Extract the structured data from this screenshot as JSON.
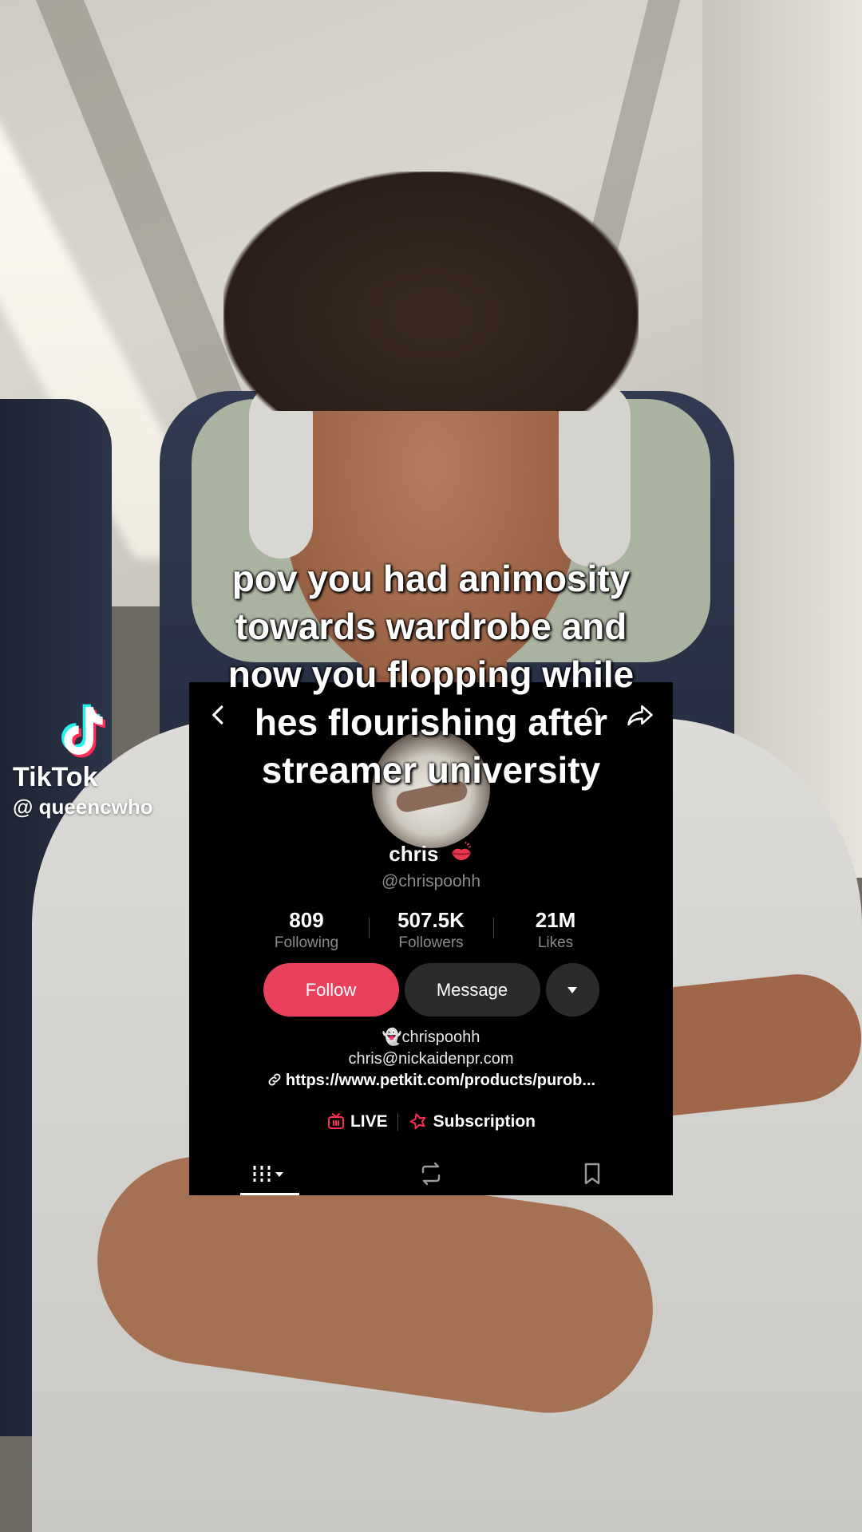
{
  "watermark": {
    "brand": "TikTok",
    "user": "@ queencwho"
  },
  "caption": [
    "pov you had animosity",
    "towards wardrobe and",
    "now you flopping while",
    "hes flourishing after",
    "streamer university"
  ],
  "profile": {
    "name": "chris",
    "name_emoji_icon": "kiss-lips-icon",
    "handle": "@chrispoohh",
    "stats": [
      {
        "value": "809",
        "label": "Following"
      },
      {
        "value": "507.5K",
        "label": "Followers"
      },
      {
        "value": "21M",
        "label": "Likes"
      }
    ],
    "follow_label": "Follow",
    "message_label": "Message",
    "bio_line1": "👻chrispoohh",
    "bio_line2": "chris@nickaidenpr.com",
    "link": "https://www.petkit.com/products/purob...",
    "live_label": "LIVE",
    "subscription_label": "Subscription"
  },
  "colors": {
    "accent": "#e9415c",
    "card_bg": "#000000",
    "secondary_text": "#8a8a8a",
    "button_dark": "#2b2b2b"
  }
}
